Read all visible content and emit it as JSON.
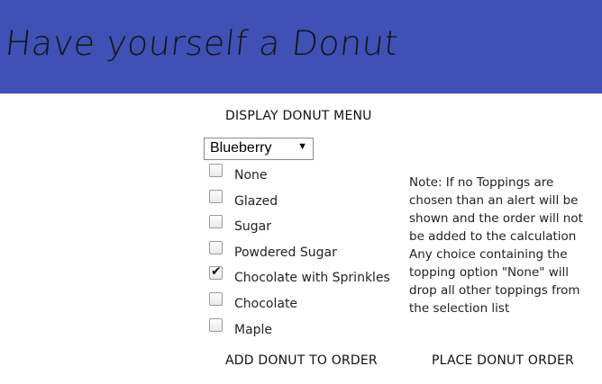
{
  "header": {
    "title": "Have yourself a Donut",
    "background_color": "#3f51b5"
  },
  "menu_button": {
    "label": "DISPLAY DONUT MENU"
  },
  "donut_select": {
    "selected": "Blueberry",
    "arrow_icon": "triangle-down-icon"
  },
  "toppings": [
    {
      "label": "None",
      "checked": false
    },
    {
      "label": "Glazed",
      "checked": false
    },
    {
      "label": "Sugar",
      "checked": false
    },
    {
      "label": "Powdered Sugar",
      "checked": false
    },
    {
      "label": "Chocolate with Sprinkles",
      "checked": true
    },
    {
      "label": "Chocolate",
      "checked": false
    },
    {
      "label": "Maple",
      "checked": false
    }
  ],
  "note": {
    "line1": "Note: If no Toppings are chosen than an alert will be shown and the order will not be added to the calculation",
    "line2": "Any choice containing the topping option \"None\" will drop all other toppings from the selection list"
  },
  "actions": {
    "add_label": "ADD DONUT TO ORDER",
    "place_label": "PLACE DONUT ORDER"
  }
}
